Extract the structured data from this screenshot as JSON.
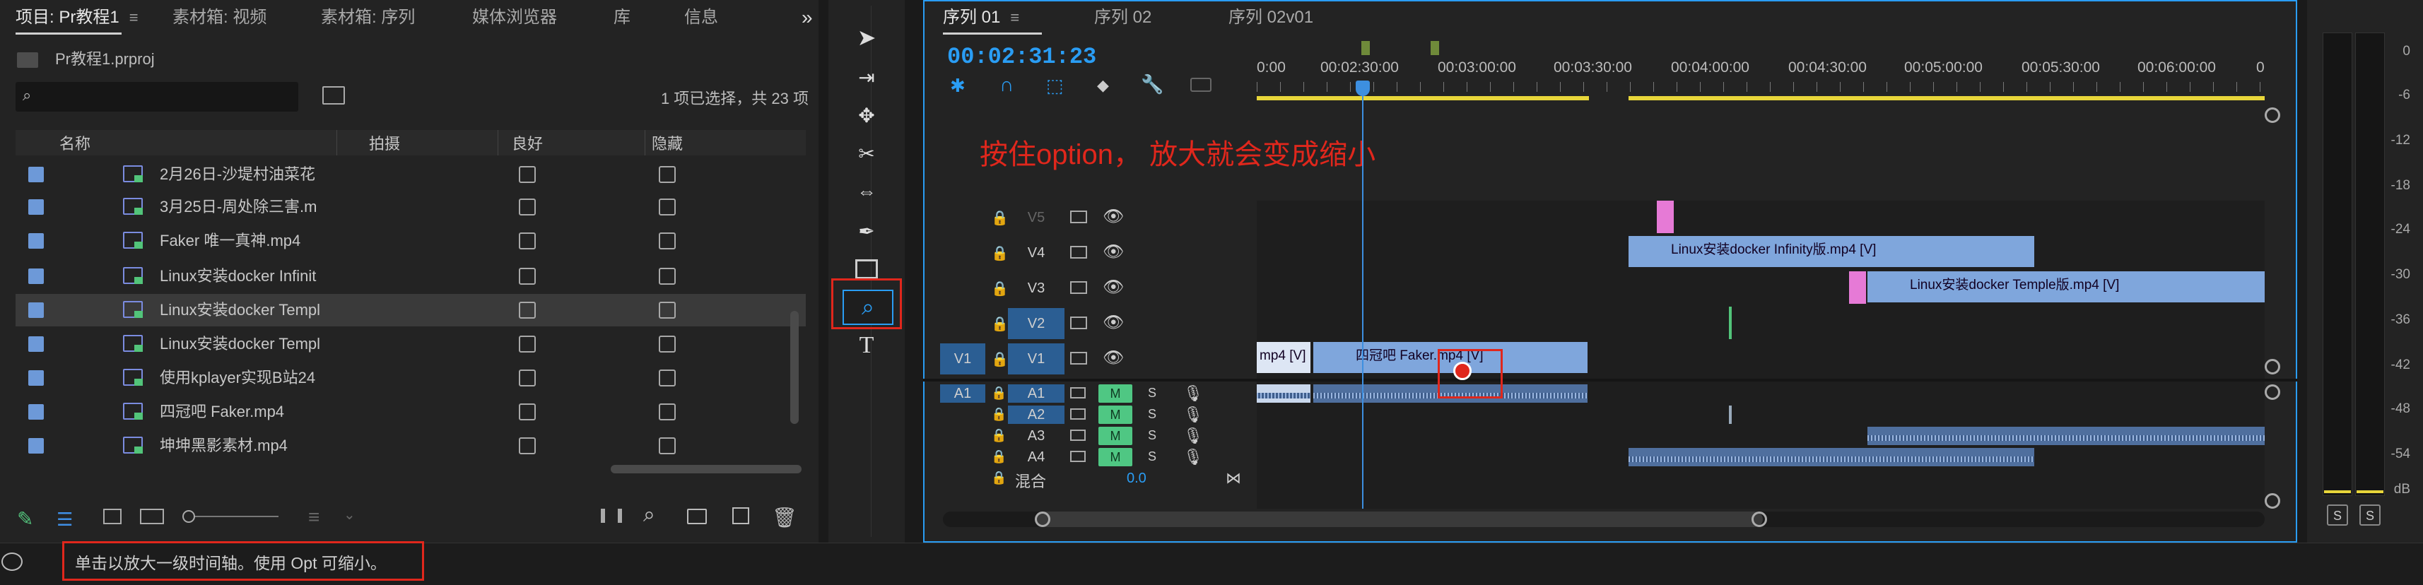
{
  "project_panel": {
    "tabs": [
      {
        "label": "项目: Pr教程1"
      },
      {
        "label": "素材箱: 视频"
      },
      {
        "label": "素材箱: 序列"
      },
      {
        "label": "媒体浏览器"
      },
      {
        "label": "库"
      },
      {
        "label": "信息"
      }
    ],
    "overflow": "»",
    "project_file": "Pr教程1.prproj",
    "search_placeholder": "",
    "selection_status": "1 项已选择，共 23 项",
    "columns": [
      "名称",
      "拍摄",
      "良好",
      "隐藏"
    ],
    "rows": [
      {
        "name": "2月26日-沙堤村油菜花",
        "selected": false
      },
      {
        "name": "3月25日-周处除三害.m",
        "selected": false
      },
      {
        "name": "Faker 唯一真神.mp4",
        "selected": false
      },
      {
        "name": "Linux安装docker Infinit",
        "selected": false
      },
      {
        "name": "Linux安装docker Templ",
        "selected": true
      },
      {
        "name": "Linux安装docker Templ",
        "selected": false
      },
      {
        "name": "使用kplayer实现B站24",
        "selected": false
      },
      {
        "name": "四冠吧 Faker.mp4",
        "selected": false
      },
      {
        "name": "坤坤黑影素材.mp4",
        "selected": false
      }
    ]
  },
  "timeline": {
    "tabs": [
      {
        "label": "序列 01",
        "active": true
      },
      {
        "label": "序列 02",
        "active": false
      },
      {
        "label": "序列 02v01",
        "active": false
      }
    ],
    "timecode": "00:02:31:23",
    "ruler": [
      "0:00",
      "00:02:30:00",
      "00:03:00:00",
      "00:03:30:00",
      "00:04:00:00",
      "00:04:30:00",
      "00:05:00:00",
      "00:05:30:00",
      "00:06:00:00",
      "0"
    ],
    "annotation": "按住option，  放大就会变成缩小",
    "video_tracks": [
      {
        "label": "V5"
      },
      {
        "label": "V4"
      },
      {
        "label": "V3"
      },
      {
        "label": "V2"
      },
      {
        "label": "V1"
      }
    ],
    "source_video": "V1",
    "source_audio": "A1",
    "audio_tracks": [
      {
        "label": "A1",
        "m": "M",
        "s": "S"
      },
      {
        "label": "A2",
        "m": "M",
        "s": "S"
      },
      {
        "label": "A3",
        "m": "M",
        "s": "S"
      },
      {
        "label": "A4",
        "m": "M",
        "s": "S"
      }
    ],
    "mix_label": "混合",
    "mix_value": "0.0",
    "clips": {
      "v4": "Linux安装docker Infinity版.mp4 [V]",
      "v3": "Linux安装docker Temple版.mp4 [V]",
      "v1a": "mp4 [V]",
      "v1b": "四冠吧 Faker.mp4 [V]"
    }
  },
  "meter": {
    "scale": [
      "0",
      "-6",
      "-12",
      "-18",
      "-24",
      "-30",
      "-36",
      "-42",
      "-48",
      "-54",
      "dB"
    ],
    "solo": [
      "S",
      "S"
    ]
  },
  "status_bar": {
    "message": "单击以放大一级时间轴。使用 Opt 可缩小。"
  },
  "colors": {
    "accent_blue": "#2a9df4",
    "highlight_red": "#e0271c",
    "clip_blue": "#7fa6dc",
    "playhead": "#3d8fe0"
  }
}
